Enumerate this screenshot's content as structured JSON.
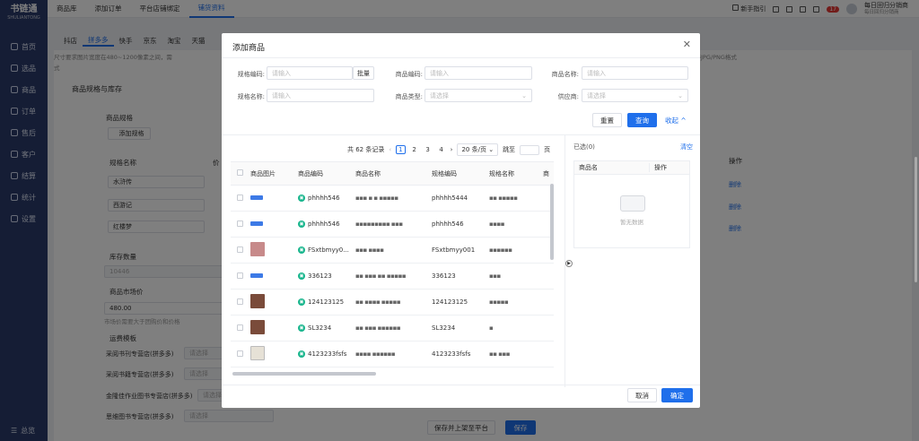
{
  "app": {
    "name": "书链通",
    "subname": "SHULIANTONG"
  },
  "sidebar": {
    "items": [
      {
        "label": "首页",
        "icon": "monitor-icon"
      },
      {
        "label": "选品",
        "icon": "box-icon"
      },
      {
        "label": "商品",
        "icon": "goods-icon"
      },
      {
        "label": "订单",
        "icon": "order-icon"
      },
      {
        "label": "售后",
        "icon": "aftersale-icon"
      },
      {
        "label": "客户",
        "icon": "user-icon"
      },
      {
        "label": "结算",
        "icon": "settle-icon"
      },
      {
        "label": "统计",
        "icon": "stats-icon"
      },
      {
        "label": "设置",
        "icon": "gear-icon"
      }
    ],
    "bottom": "总览"
  },
  "topnav": {
    "items": [
      "商品库",
      "添加订单",
      "平台店铺绑定",
      "铺货资料"
    ],
    "active": 3
  },
  "topright": {
    "guide": "新手指引",
    "badge": "17",
    "user_name": "每日回归分销商",
    "user_sub": "每日回归分销商"
  },
  "subtabs": {
    "items": [
      "抖店",
      "拼多多",
      "快手",
      "京东",
      "淘宝",
      "天猫"
    ],
    "active": 1
  },
  "background": {
    "notice": "尺寸要求图片宽度在480~1200像素之间，需",
    "notice_tail": "支持JPG/PNG格式",
    "notice_2": "式",
    "section_title": "商品规格与库存",
    "spec_label": "商品规格",
    "add_spec": "添加规格",
    "spec_name_col": "规格名称",
    "spec_col2": "价",
    "op_col": "操作",
    "specs": [
      "水浒传",
      "西游记",
      "红楼梦"
    ],
    "delete_label": "删除",
    "stock_label": "库存数量",
    "stock_value": "10446",
    "market_price_label": "商品市场价",
    "market_price_value": "480.00",
    "market_price_hint": "市场价需要大于团购价和价格",
    "freight_label": "运费模板",
    "freight_rows": [
      "采阅书刊专营店(拼多多)",
      "采阅书籍专营店(拼多多)",
      "金隆佳作业图书专营店(拼多多)",
      "思维图书专营店(拼多多)"
    ],
    "freight_placeholder": "请选择",
    "save_publish": "保存并上架至平台",
    "save": "保存"
  },
  "modal": {
    "title": "添加商品",
    "filters": {
      "spec_code": {
        "label": "规格编码:",
        "placeholder": "请输入",
        "addon": "批量"
      },
      "product_code": {
        "label": "商品编码:",
        "placeholder": "请输入"
      },
      "product_name": {
        "label": "商品名称:",
        "placeholder": "请输入"
      },
      "spec_name": {
        "label": "规格名称:",
        "placeholder": "请输入"
      },
      "product_type": {
        "label": "商品类型:",
        "placeholder": "请选择"
      },
      "supplier": {
        "label": "供应商:",
        "placeholder": "请选择"
      }
    },
    "reset": "重置",
    "search": "查询",
    "collapse": "收起",
    "pagination": {
      "total": "共 62 条记录",
      "pages": [
        "1",
        "2",
        "3",
        "4"
      ],
      "current": "1",
      "page_size": "20 条/页",
      "jump_label": "跳至",
      "page_suffix": "页"
    },
    "table": {
      "headers": [
        "商品图片",
        "商品编码",
        "商品名称",
        "规格编码",
        "规格名称",
        "商"
      ],
      "rows": [
        {
          "thumb": "logo",
          "code": "phhhh546",
          "name": "▪▪▪ ▪ ▪ ▪▪▪▪▪",
          "spec_code": "phhhh5444",
          "spec_name": "▪▪ ▪▪▪▪▪"
        },
        {
          "thumb": "logo",
          "code": "phhhh546",
          "name": "▪▪▪▪▪▪▪▪▪ ▪▪▪",
          "spec_code": "phhhh546",
          "spec_name": "▪▪▪▪"
        },
        {
          "thumb": "pink",
          "code": "FSxtbmyy0...",
          "name": "▪▪▪ ▪▪▪▪",
          "spec_code": "FSxtbmyy001",
          "spec_name": "▪▪▪▪▪▪"
        },
        {
          "thumb": "logo",
          "code": "336123",
          "name": "▪▪ ▪▪▪ ▪▪ ▪▪▪▪▪",
          "spec_code": "336123",
          "spec_name": "▪▪▪"
        },
        {
          "thumb": "face",
          "code": "124123125",
          "name": "▪▪ ▪▪▪▪ ▪▪▪▪▪",
          "spec_code": "124123125",
          "spec_name": "▪▪▪▪▪"
        },
        {
          "thumb": "face",
          "code": "SL3234",
          "name": "▪▪ ▪▪▪ ▪▪▪▪▪▪",
          "spec_code": "SL3234",
          "spec_name": "▪"
        },
        {
          "thumb": "doc",
          "code": "4123233fsfs",
          "name": "▪▪▪▪ ▪▪▪▪▪▪",
          "spec_code": "4123233fsfs",
          "spec_name": "▪▪ ▪▪▪"
        }
      ]
    },
    "selected": {
      "title": "已选(0)",
      "clear": "清空",
      "col_name": "商品名",
      "col_op": "操作",
      "empty": "暂无数据"
    },
    "cancel": "取消",
    "confirm": "确定"
  }
}
